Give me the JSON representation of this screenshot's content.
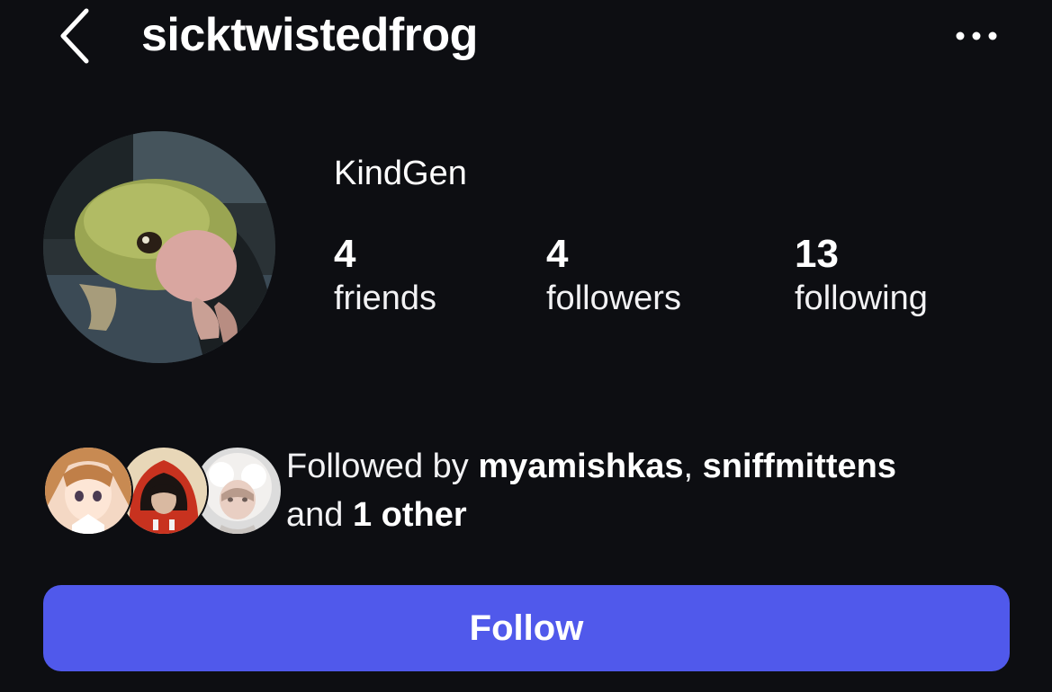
{
  "header": {
    "username": "sicktwistedfrog",
    "back_icon": "chevron-left-icon",
    "more_icon": "ellipsis-icon"
  },
  "profile": {
    "display_name": "KindGen",
    "avatar": "frog-photo",
    "stats": {
      "friends": {
        "count": "4",
        "label": "friends"
      },
      "followers": {
        "count": "4",
        "label": "followers"
      },
      "following": {
        "count": "13",
        "label": "following"
      }
    }
  },
  "followed_by": {
    "prefix": "Followed by ",
    "user1": "myamishkas",
    "separator": ", ",
    "user2": "sniffmittens",
    "connector": "and ",
    "others": "1 other"
  },
  "actions": {
    "follow_label": "Follow"
  },
  "colors": {
    "background": "#0d0e12",
    "accent": "#5059eb",
    "text": "#ffffff"
  }
}
